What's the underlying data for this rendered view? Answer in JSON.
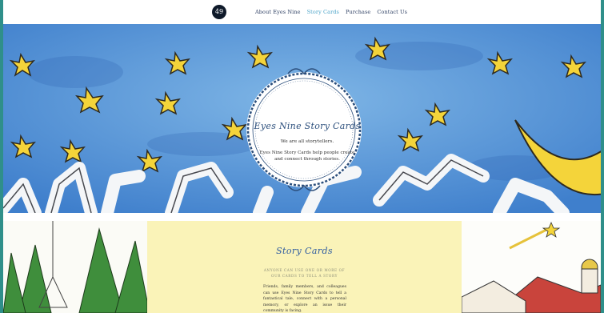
{
  "header": {
    "logo_text": "49",
    "nav": [
      {
        "label": "About Eyes Nine",
        "active": false
      },
      {
        "label": "Story Cards",
        "active": true
      },
      {
        "label": "Purchase",
        "active": false
      },
      {
        "label": "Contact Us",
        "active": false
      }
    ]
  },
  "hero": {
    "title": "Eyes Nine Story Cards",
    "tagline": "We are all storytellers.",
    "description": "Eyes Nine Story Cards help people create and connect through stories."
  },
  "story_cards": {
    "title": "Story Cards",
    "subtitle_line1": "Anyone can use one or more of",
    "subtitle_line2": "our cards to tell a story",
    "body": "Friends, family members, and colleagues can use Eyes Nine Story Cards to tell a fantastical tale, connect with a personal memory, or explore an issue their community is facing."
  },
  "colors": {
    "accent_nav": "#4aa3c8",
    "nav_text": "#2c3e62",
    "sky": "#5aa0d8",
    "panel": "#faf3b8",
    "frame": "#2f8f8a"
  },
  "icons": [
    "logo-mark",
    "star-icon",
    "moon-icon",
    "shooting-star-icon"
  ]
}
